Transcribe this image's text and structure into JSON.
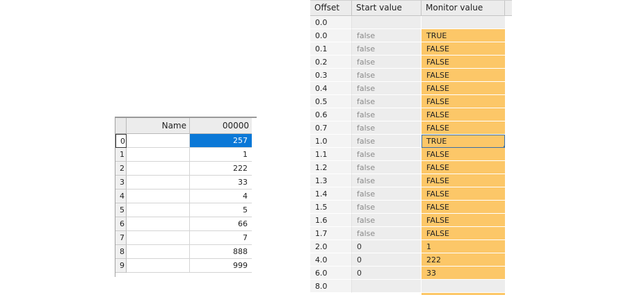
{
  "left_grid": {
    "headers": {
      "name": "Name",
      "value": "00000"
    },
    "rows": [
      {
        "index": "0",
        "value": "257"
      },
      {
        "index": "1",
        "value": "1"
      },
      {
        "index": "2",
        "value": "222"
      },
      {
        "index": "3",
        "value": "33"
      },
      {
        "index": "4",
        "value": "4"
      },
      {
        "index": "5",
        "value": "5"
      },
      {
        "index": "6",
        "value": "66"
      },
      {
        "index": "7",
        "value": "7"
      },
      {
        "index": "8",
        "value": "888"
      },
      {
        "index": "9",
        "value": "999"
      }
    ]
  },
  "right_table": {
    "headers": {
      "offset": "Offset",
      "start": "Start value",
      "monitor": "Monitor value"
    },
    "rows": [
      {
        "offset": "0.0",
        "start": "",
        "monitor": ""
      },
      {
        "offset": "0.0",
        "start": "false",
        "monitor": "TRUE"
      },
      {
        "offset": "0.1",
        "start": "false",
        "monitor": "FALSE"
      },
      {
        "offset": "0.2",
        "start": "false",
        "monitor": "FALSE"
      },
      {
        "offset": "0.3",
        "start": "false",
        "monitor": "FALSE"
      },
      {
        "offset": "0.4",
        "start": "false",
        "monitor": "FALSE"
      },
      {
        "offset": "0.5",
        "start": "false",
        "monitor": "FALSE"
      },
      {
        "offset": "0.6",
        "start": "false",
        "monitor": "FALSE"
      },
      {
        "offset": "0.7",
        "start": "false",
        "monitor": "FALSE"
      },
      {
        "offset": "1.0",
        "start": "false",
        "monitor": "TRUE"
      },
      {
        "offset": "1.1",
        "start": "false",
        "monitor": "FALSE"
      },
      {
        "offset": "1.2",
        "start": "false",
        "monitor": "FALSE"
      },
      {
        "offset": "1.3",
        "start": "false",
        "monitor": "FALSE"
      },
      {
        "offset": "1.4",
        "start": "false",
        "monitor": "FALSE"
      },
      {
        "offset": "1.5",
        "start": "false",
        "monitor": "FALSE"
      },
      {
        "offset": "1.6",
        "start": "false",
        "monitor": "FALSE"
      },
      {
        "offset": "1.7",
        "start": "false",
        "monitor": "FALSE"
      },
      {
        "offset": "2.0",
        "start": "0",
        "monitor": "1"
      },
      {
        "offset": "4.0",
        "start": "0",
        "monitor": "222"
      },
      {
        "offset": "6.0",
        "start": "0",
        "monitor": "33"
      },
      {
        "offset": "8.0",
        "start": "",
        "monitor": ""
      }
    ]
  },
  "colors": {
    "selection_blue": "#0a78d7",
    "monitor_orange": "#fcc768",
    "header_gray": "#ececec"
  }
}
